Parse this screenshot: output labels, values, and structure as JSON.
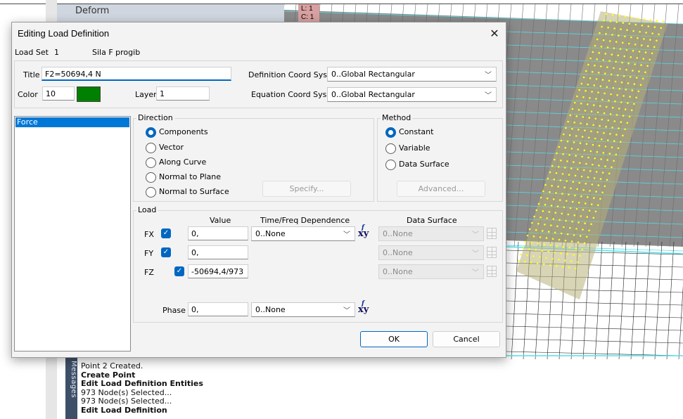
{
  "background": {
    "tree_item": "Deform",
    "messages_tab": "Messages",
    "messages": [
      {
        "text": "Point 2 Created.",
        "bold": false
      },
      {
        "text": "Create Point",
        "bold": true
      },
      {
        "text": "Edit Load Definition Entities",
        "bold": true
      },
      {
        "text": "973 Node(s) Selected...",
        "bold": false
      },
      {
        "text": "973 Node(s) Selected...",
        "bold": false
      },
      {
        "text": "Edit Load Definition",
        "bold": true
      }
    ],
    "viewport_labels": [
      "L: 1",
      "C: 1"
    ]
  },
  "dialog": {
    "title": "Editing Load Definition",
    "close_icon": "close-icon",
    "load_set_label": "Load Set",
    "load_set_number": "1",
    "load_set_name": "Sila F progib",
    "title_label": "Title",
    "title_value": "F2=50694,4 N",
    "color_label": "Color",
    "color_value": "10",
    "color_swatch": "#008000",
    "layer_label": "Layer",
    "layer_value": "1",
    "def_coord_label": "Definition Coord Sys",
    "def_coord_value": "0..Global Rectangular",
    "eq_coord_label": "Equation Coord Sys",
    "eq_coord_value": "0..Global Rectangular",
    "load_types": [
      "Force"
    ],
    "direction": {
      "legend": "Direction",
      "options": [
        "Components",
        "Vector",
        "Along Curve",
        "Normal to Plane",
        "Normal to Surface"
      ],
      "selected": "Components",
      "specify_button": "Specify..."
    },
    "method": {
      "legend": "Method",
      "options": [
        "Constant",
        "Variable",
        "Data Surface"
      ],
      "selected": "Constant",
      "advanced_button": "Advanced..."
    },
    "load": {
      "legend": "Load",
      "headers": {
        "value": "Value",
        "time": "Time/Freq Dependence",
        "surface": "Data Surface"
      },
      "rows": [
        {
          "label": "FX",
          "checked": true,
          "value": "0,",
          "time": "0..None",
          "surface": "0..None"
        },
        {
          "label": "FY",
          "checked": true,
          "value": "0,",
          "time": "",
          "surface": "0..None"
        },
        {
          "label": "FZ",
          "checked": true,
          "value": "-50694,4/973",
          "time": "",
          "surface": "0..None"
        }
      ],
      "phase_label": "Phase",
      "phase_value": "0,",
      "phase_time": "0..None"
    },
    "ok_button": "OK",
    "cancel_button": "Cancel",
    "accent_color": "#0067c0"
  }
}
